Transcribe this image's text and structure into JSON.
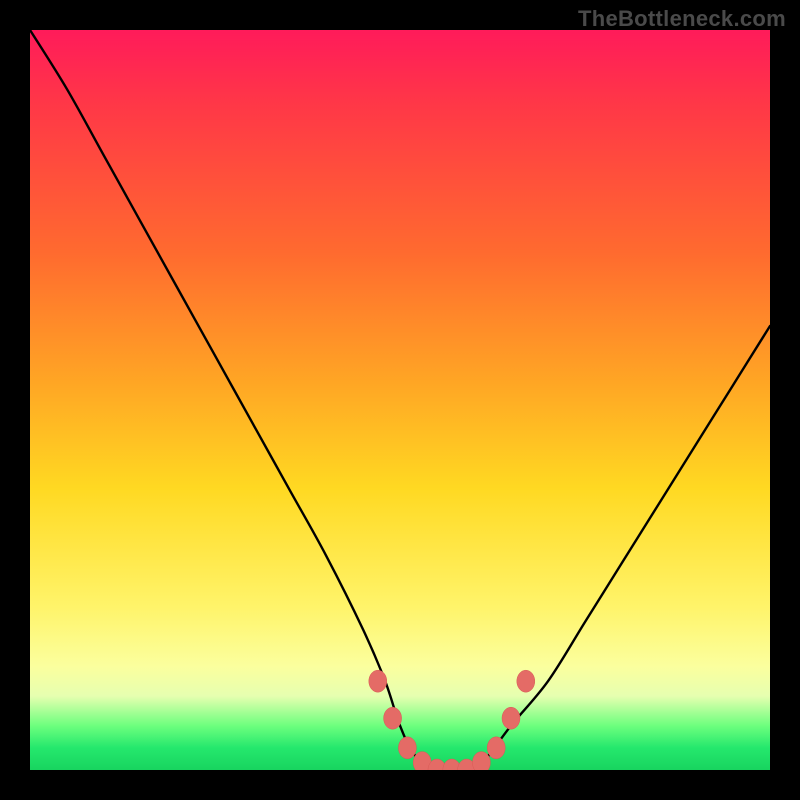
{
  "watermark": "TheBottleneck.com",
  "chart_data": {
    "type": "line",
    "title": "",
    "xlabel": "",
    "ylabel": "",
    "xlim": [
      0,
      100
    ],
    "ylim": [
      0,
      100
    ],
    "series": [
      {
        "name": "bottleneck-curve",
        "x": [
          0,
          5,
          10,
          15,
          20,
          25,
          30,
          35,
          40,
          45,
          48,
          50,
          52,
          55,
          58,
          60,
          62,
          65,
          70,
          75,
          80,
          85,
          90,
          95,
          100
        ],
        "y": [
          100,
          92,
          83,
          74,
          65,
          56,
          47,
          38,
          29,
          19,
          12,
          6,
          2,
          0,
          0,
          0,
          2,
          6,
          12,
          20,
          28,
          36,
          44,
          52,
          60
        ]
      }
    ],
    "markers": {
      "name": "highlighted-points",
      "x": [
        47,
        49,
        51,
        53,
        55,
        57,
        59,
        61,
        63,
        65,
        67
      ],
      "y": [
        12,
        7,
        3,
        1,
        0,
        0,
        0,
        1,
        3,
        7,
        12
      ]
    },
    "background_gradient": {
      "top": "#ff1b5a",
      "mid_upper": "#ff6a2f",
      "mid": "#ffd922",
      "mid_lower": "#fbff9e",
      "bottom": "#18d45f"
    }
  }
}
